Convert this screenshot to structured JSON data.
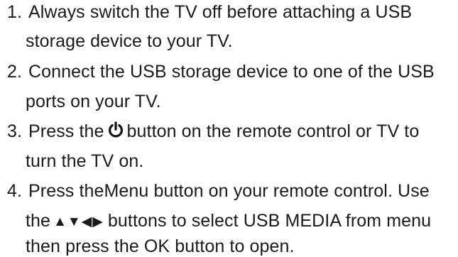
{
  "steps": [
    {
      "number": "1.",
      "line1": "Always switch the TV off before attaching a USB",
      "line2": "storage device to your TV."
    },
    {
      "number": "2.",
      "line1": "Connect the USB storage device to one of the USB",
      "line2": "ports on your TV."
    },
    {
      "number": "3.",
      "line1_before_icon": "Press the",
      "icon": "power-icon",
      "line1_after_icon": "button on the remote control or TV to",
      "line2": "turn the TV on."
    },
    {
      "number": "4.",
      "line1": "Press theMenu button on your remote control. Use",
      "line2_before_arrows": "the",
      "arrows": "▲▼◀▶",
      "line2_after_arrows": "buttons to select USB MEDIA from menu",
      "line3": "then press the OK button to open."
    }
  ]
}
